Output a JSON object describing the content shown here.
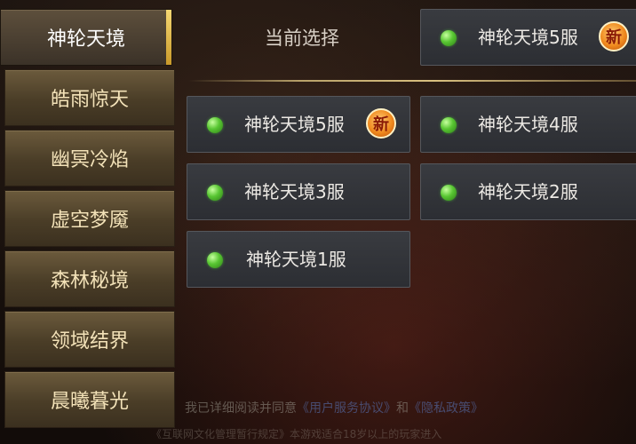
{
  "sidebar": {
    "tabs": [
      {
        "label": "神轮天境",
        "active": true
      },
      {
        "label": "皓雨惊天",
        "active": false
      },
      {
        "label": "幽冥冷焰",
        "active": false
      },
      {
        "label": "虚空梦魇",
        "active": false
      },
      {
        "label": "森林秘境",
        "active": false
      },
      {
        "label": "领域结界",
        "active": false
      },
      {
        "label": "晨曦暮光",
        "active": false
      }
    ]
  },
  "current_selection": {
    "label": "当前选择",
    "server": {
      "name": "神轮天境5服",
      "badge": "新",
      "status_icon": "green-dot-icon"
    }
  },
  "servers": [
    {
      "name": "神轮天境5服",
      "badge": "新"
    },
    {
      "name": "神轮天境4服",
      "badge": ""
    },
    {
      "name": "神轮天境3服",
      "badge": ""
    },
    {
      "name": "神轮天境2服",
      "badge": ""
    },
    {
      "name": "神轮天境1服",
      "badge": ""
    }
  ],
  "footer": {
    "agreement_prefix": "我已详细阅读并同意",
    "agreement_link1": "《用户服务协议》",
    "agreement_and": "和",
    "agreement_link2": "《隐私政策》",
    "notice": "《互联网文化管理暂行规定》本游戏适合18岁以上的玩家进入"
  },
  "colors": {
    "status_online": "#58c632",
    "badge_new": "#f08a1e",
    "tab_active_accent": "#e8c45a",
    "divider": "#d9c080"
  }
}
